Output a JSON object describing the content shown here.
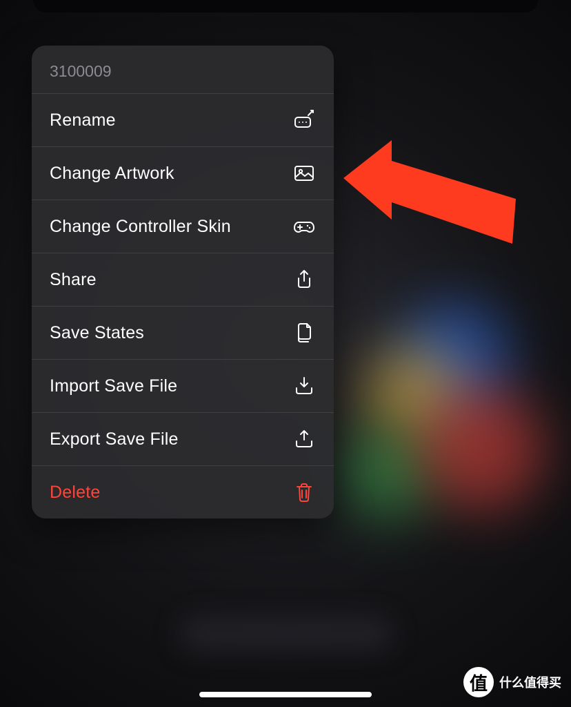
{
  "popover": {
    "title": "3100009",
    "items": [
      {
        "label": "Rename",
        "icon": "rename-icon"
      },
      {
        "label": "Change Artwork",
        "icon": "image-icon"
      },
      {
        "label": "Change Controller Skin",
        "icon": "controller-icon"
      },
      {
        "label": "Share",
        "icon": "share-icon"
      },
      {
        "label": "Save States",
        "icon": "documents-icon"
      },
      {
        "label": "Import Save File",
        "icon": "import-icon"
      },
      {
        "label": "Export Save File",
        "icon": "export-icon"
      },
      {
        "label": "Delete",
        "icon": "trash-icon",
        "destructive": true
      }
    ]
  },
  "watermark": {
    "badge": "值",
    "text": "什么值得买"
  },
  "annotation": {
    "arrow_points_to_item_index": 1,
    "arrow_color": "#ff3b1f"
  }
}
